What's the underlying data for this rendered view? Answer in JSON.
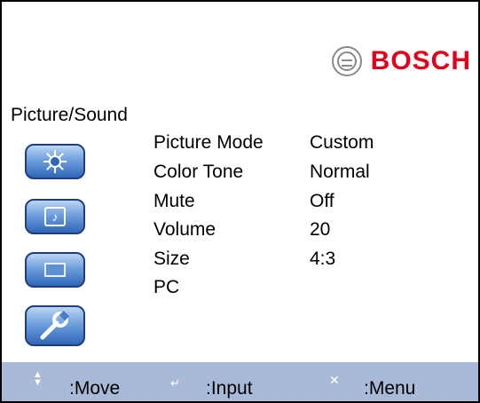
{
  "logo": {
    "brand": "BOSCH",
    "mark_icon": "bosch-armature-icon"
  },
  "menu": {
    "title": "Picture/Sound"
  },
  "sidebar": {
    "items": [
      {
        "icon": "brightness-icon"
      },
      {
        "icon": "music-note-icon"
      },
      {
        "icon": "screen-window-icon"
      },
      {
        "icon": "wrench-icon"
      }
    ]
  },
  "settings": [
    {
      "label": "Picture Mode",
      "value": "Custom"
    },
    {
      "label": "Color Tone",
      "value": "Normal"
    },
    {
      "label": "Mute",
      "value": "Off"
    },
    {
      "label": "Volume",
      "value": "20"
    },
    {
      "label": "Size",
      "value": "4:3"
    },
    {
      "label": "PC",
      "value": ""
    }
  ],
  "footer": {
    "move_label": ":Move",
    "input_label": ":Input",
    "menu_label": ":Menu",
    "move_icon": "up-down-arrow-icon",
    "input_icon": "enter-icon",
    "menu_icon": "close-icon",
    "background": "#a9b9d8"
  },
  "colors": {
    "brand_red": "#e2001a",
    "icon_blue": "#2f66b8"
  }
}
